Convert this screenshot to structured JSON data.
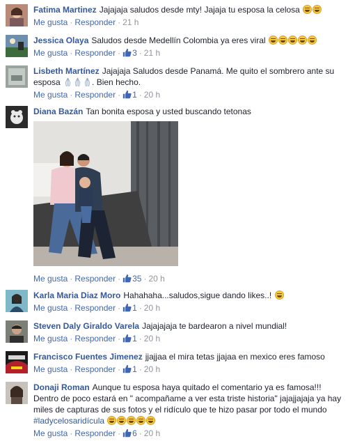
{
  "comments": [
    {
      "author": "Fatima Martinez",
      "text": "Jajajaja saludos desde mty! Jajaja tu esposa la celosa",
      "emoji_count": 2,
      "like_label": "Me gusta",
      "reply_label": "Responder",
      "likes": "",
      "time": "21 h"
    },
    {
      "author": "Jessica Olaya",
      "text": "Saludos desde Medellín Colombia ya eres viral",
      "emoji_count": 5,
      "like_label": "Me gusta",
      "reply_label": "Responder",
      "likes": "3",
      "time": "21 h"
    },
    {
      "author": "Lisbeth Martínez",
      "text": "Jajajaja Saludos desde Panamá. Me quito el sombrero ante su esposa",
      "text_after": ". Bien hecho.",
      "like_label": "Me gusta",
      "reply_label": "Responder",
      "likes": "1",
      "time": "20 h"
    },
    {
      "author": "Diana Bazán",
      "text": "Tan bonita esposa y usted buscando tetonas",
      "like_label": "Me gusta",
      "reply_label": "Responder",
      "likes": "35",
      "time": "20 h"
    },
    {
      "author": "Karla Maria Diaz Moro",
      "text": "Hahahaha...saludos,sigue dando likes..!",
      "like_label": "Me gusta",
      "reply_label": "Responder",
      "likes": "1",
      "time": "20 h"
    },
    {
      "author": "Steven Daly Giraldo Varela",
      "text": "Jajajajaja te bardearon a nivel mundial!",
      "like_label": "Me gusta",
      "reply_label": "Responder",
      "likes": "1",
      "time": "20 h"
    },
    {
      "author": "Francisco Fuentes Jimenez",
      "text": "jjajjaa el mira tetas jjajaa en mexico eres famoso",
      "like_label": "Me gusta",
      "reply_label": "Responder",
      "likes": "1",
      "time": "20 h"
    },
    {
      "author": "Donaji Roman",
      "text": "Aunque tu esposa haya quitado el comentario ya es famosa!!! Dentro de poco estará en \" acompañame a ver esta triste historia\" jajajjajaja ya hay miles de capturas de sus fotos y el ridículo que te hizo pasar por todo el mundo",
      "hashtag": "#ladycelosaridícula",
      "like_label": "Me gusta",
      "reply_label": "Responder",
      "likes": "6",
      "time": "20 h"
    }
  ],
  "colors": {
    "author": "#365899",
    "action": "#4267b2",
    "meta": "#90949c"
  }
}
